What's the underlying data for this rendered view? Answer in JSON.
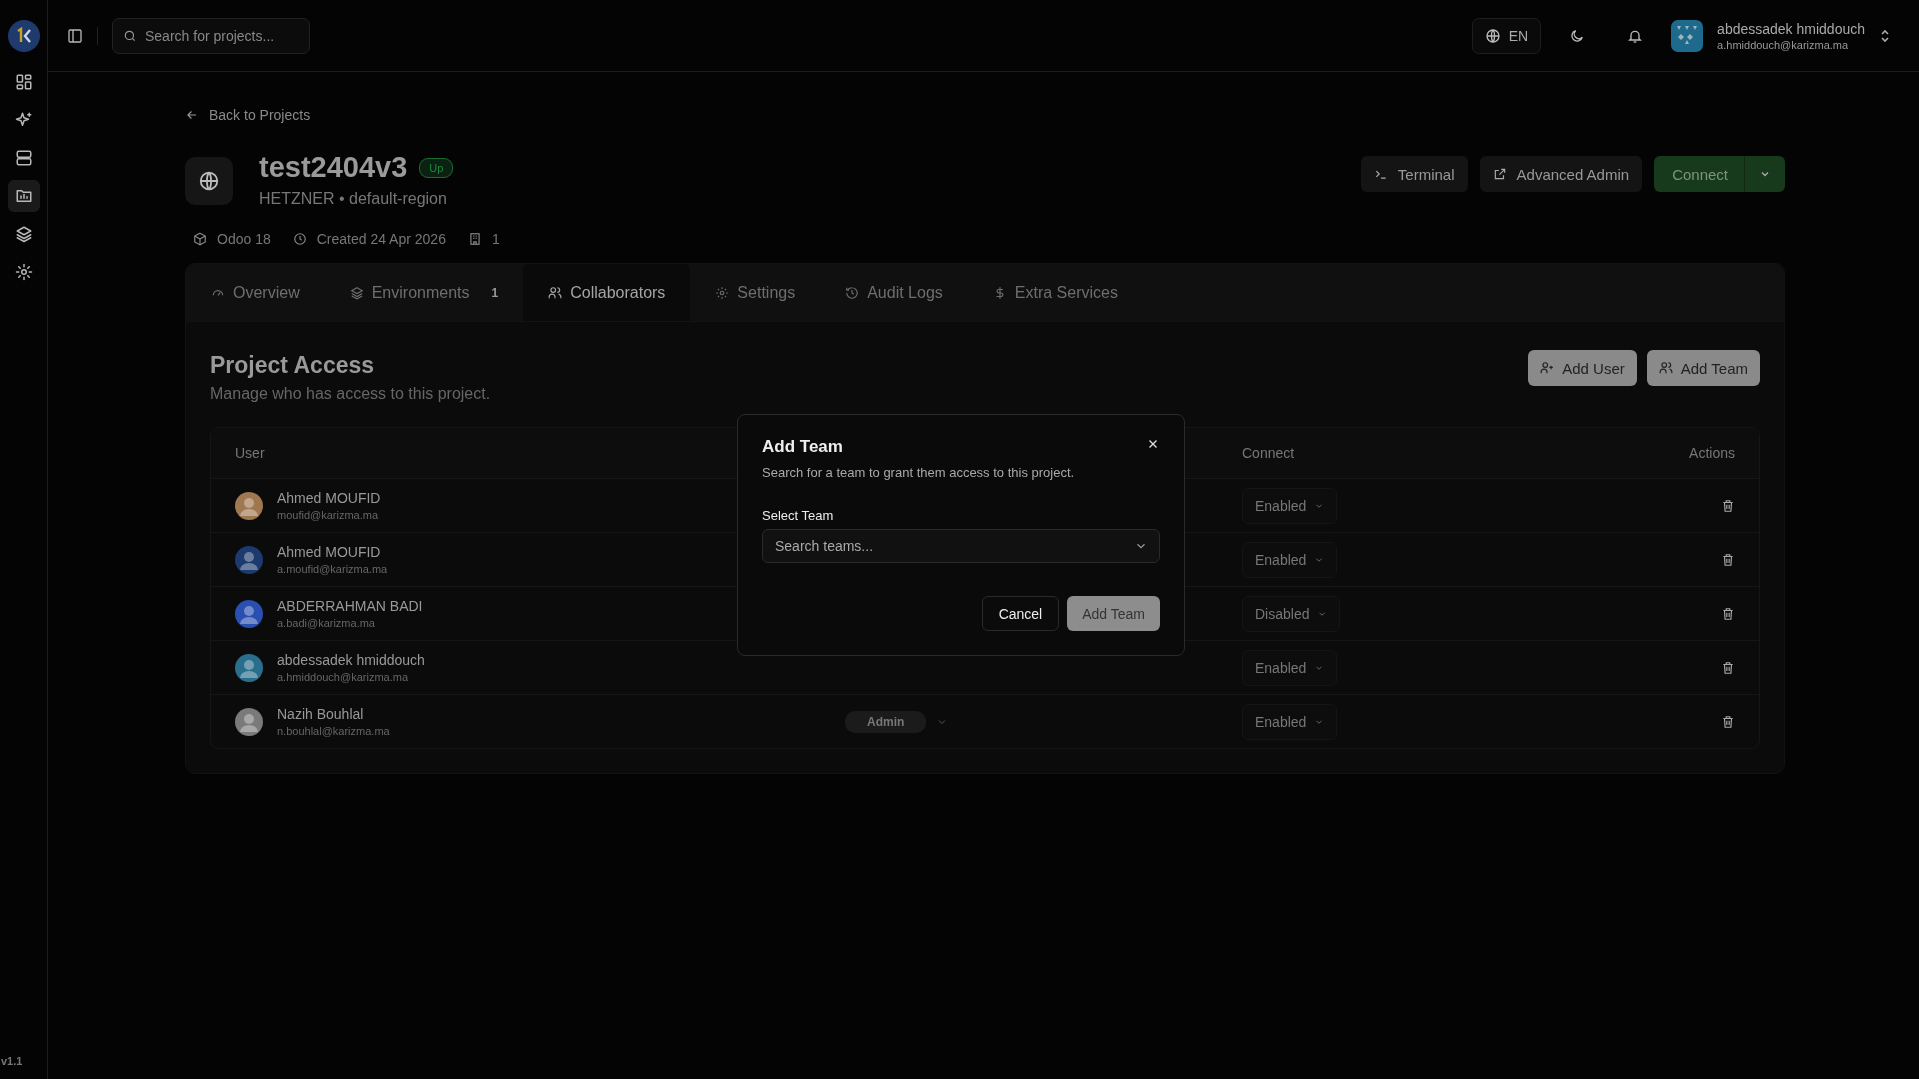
{
  "sidebar": {
    "items": [
      {
        "selected": false
      },
      {
        "selected": false
      },
      {
        "selected": false
      },
      {
        "selected": true
      },
      {
        "selected": false
      },
      {
        "selected": false
      }
    ],
    "version": "v1.1"
  },
  "topbar": {
    "search": {
      "placeholder": "Search for projects..."
    },
    "language": "EN",
    "user": {
      "name": "abdessadek hmiddouch",
      "email": "a.hmiddouch@karizma.ma"
    }
  },
  "back_link": "Back to Projects",
  "project": {
    "name": "test2404v3",
    "status": "Up",
    "provider": "HETZNER • default-region",
    "version": "Odoo 18",
    "created": "Created 24 Apr 2026",
    "count": "1"
  },
  "actions": [
    "Terminal",
    "Advanced Admin",
    "Connect"
  ],
  "tabs": [
    {
      "label": "Overview",
      "selected": false
    },
    {
      "label": "Environments",
      "count": "1",
      "selected": false
    },
    {
      "label": "Collaborators",
      "selected": true
    },
    {
      "label": "Settings",
      "selected": false
    },
    {
      "label": "Audit Logs",
      "selected": false
    },
    {
      "label": "Extra Services",
      "selected": false
    }
  ],
  "section": {
    "title": "Project Access",
    "subtitle": "Manage who has access to this project.",
    "buttons": [
      "Add User",
      "Add Team"
    ]
  },
  "table": {
    "columns": [
      "User",
      "Connect",
      "Actions"
    ],
    "rows": [
      {
        "name": "Ahmed MOUFID",
        "email": "moufid@karizma.ma",
        "connect": "Enabled",
        "color": "#a07850"
      },
      {
        "name": "Ahmed MOUFID",
        "email": "a.moufid@karizma.ma",
        "connect": "Enabled",
        "color": "#1c3a6e"
      },
      {
        "name": "ABDERRAHMAN BADI",
        "email": "a.badi@karizma.ma",
        "connect": "Disabled",
        "color": "#2a4fb0"
      },
      {
        "name": "abdessadek hmiddouch",
        "email": "a.hmiddouch@karizma.ma",
        "connect": "Enabled",
        "color": "#2a6e8e"
      },
      {
        "name": "Nazih Bouhlal",
        "email": "n.bouhlal@karizma.ma",
        "role": "Admin",
        "connect": "Enabled",
        "color": "#7a7a7a"
      }
    ]
  },
  "dialog": {
    "title": "Add Team",
    "description": "Search for a team to grant them access to this project.",
    "field_label": "Select Team",
    "placeholder": "Search teams...",
    "buttons": [
      "Cancel",
      "Add Team"
    ]
  }
}
